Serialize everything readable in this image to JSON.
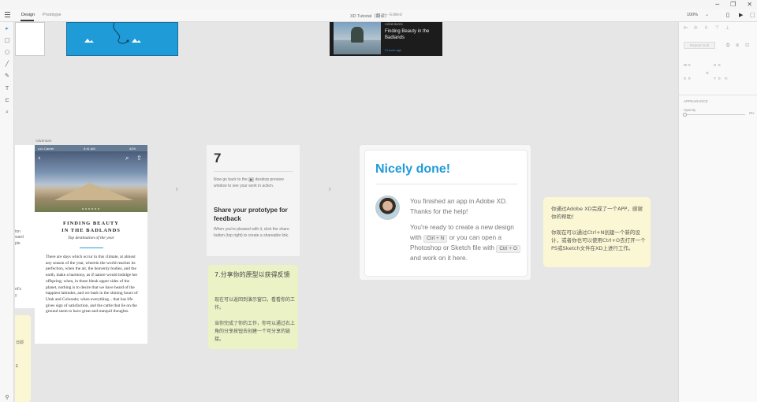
{
  "window": {
    "minimize": "─",
    "restore": "❐",
    "close": "✕"
  },
  "menubar": {
    "tabs": [
      "Design",
      "Prototype"
    ],
    "doc_title": "XD Tutorial（翻译）",
    "doc_status": "— Edited",
    "zoom": "100%",
    "icons": [
      "mobile-preview-icon",
      "play-icon",
      "share-icon"
    ]
  },
  "tools": [
    "select-tool-icon",
    "rectangle-tool-icon",
    "ellipse-tool-icon",
    "line-tool-icon",
    "pen-tool-icon",
    "text-tool-icon",
    "artboard-tool-icon",
    "zoom-tool-icon"
  ],
  "panel": {
    "repeat_grid": "Repeat Grid",
    "w_label": "W",
    "w_value": "0",
    "h_label": "H",
    "h_value": "0",
    "x_label": "X",
    "x_value": "0",
    "y_label": "Y",
    "y_value": "0",
    "appearance": "APPEARANCE",
    "opacity": "Opacity",
    "opacity_value": "0%"
  },
  "dark_card": {
    "kicker": "Adventures",
    "title": "Finding Beauty in the Badlands",
    "time": "3 hours ago"
  },
  "left_fragments": [
    "ton",
    "ward",
    "ple",
    "rd's",
    "y"
  ],
  "left_yellow_fragments": [
    "日即",
    "E"
  ],
  "mobile": {
    "label": "Adventure",
    "carrier": "••••• Carrier",
    "time": "9:41 AM",
    "battery": "42%",
    "title_line1": "FINDING BEAUTY",
    "title_line2": "IN THE BADLANDS",
    "subtitle": "Top destination of the year",
    "body": "There are days which occur in this climate, at almost any season of the year, wherein the world reaches its perfection, when the air, the heavenly bodies, and the earth, make a harmony, as if nature would indulge her offspring; when, in these bleak upper sides of the planet, nothing is to desire that we have heard of the happiest latitudes, and we bask in the shining hours of Utah and Colorado; when everything... that has life gives sign of satisfaction, and the cattle that lie on the ground seem to have great and tranquil thoughts."
  },
  "step": {
    "number": "7",
    "intro_before": "Now go back to the",
    "intro_after": "desktop preview window to see your work in action.",
    "heading": "Share your prototype for feedback",
    "body": "When you're pleased with it, click the share button (top right) to create a shareable link."
  },
  "note_cn": {
    "heading": "7.分享你的原型以获得反馈",
    "p1": "现在可以返回到演示窗口，看看你的工作。",
    "p2": "当你完成了你的工作，你可以通过右上角的分享按钮去创建一个可分享的链接。"
  },
  "done": {
    "title": "Nicely done!",
    "p1": "You finished an app in Adobe XD. Thanks for the help!",
    "p2_a": "You're ready to create a new design with",
    "kbd1": "Ctrl + N",
    "p2_b": "or you can open a Photoshop or Sketch file with",
    "kbd2": "Ctrl + O",
    "p2_c": "and work on it here."
  },
  "note_cn2": {
    "p1": "你通过Adobe XD完成了一个APP，感谢你的帮助！",
    "p2": "你现在可以通过Ctrl+N创建一个新的设计，或者你也可以使用Ctrl+O去打开一个PS或Sketch文件在XD上进行工作。"
  },
  "colors": {
    "accent": "#1f9bd8",
    "note_green": "#eaf2c6",
    "note_yellow": "#fbf7d5"
  }
}
